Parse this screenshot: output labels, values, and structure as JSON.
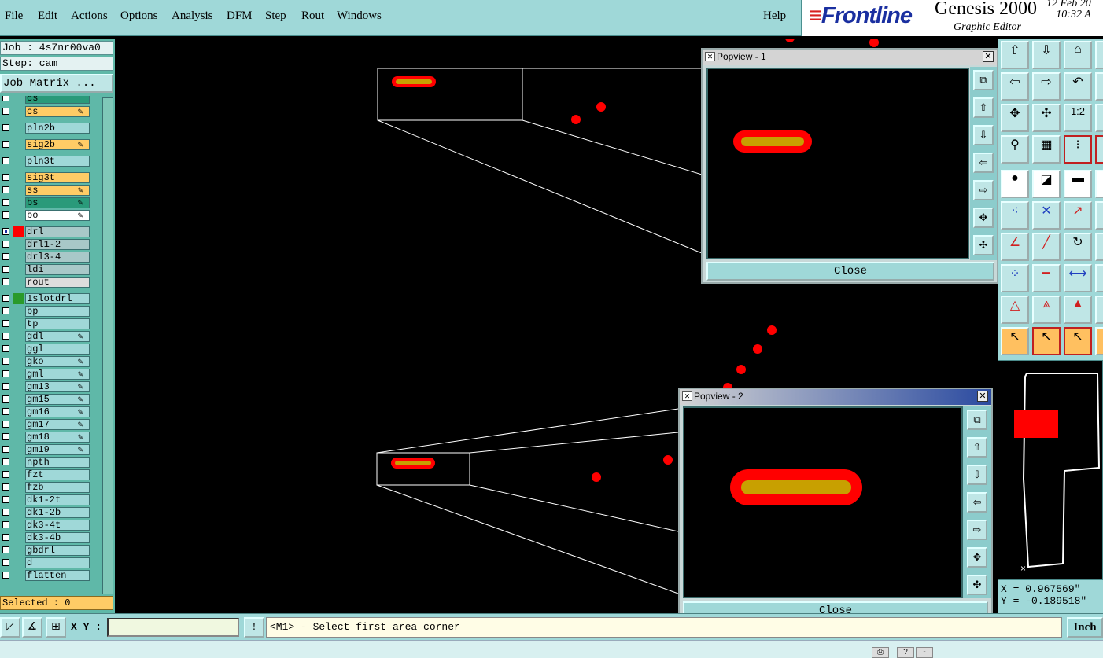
{
  "menu": {
    "items": [
      "File",
      "Edit",
      "Actions",
      "Options",
      "Analysis",
      "DFM",
      "Step",
      "Rout",
      "Windows"
    ],
    "help": "Help"
  },
  "branding": {
    "company": "Frontline",
    "product": "Genesis 2000",
    "subtitle": "Graphic Editor",
    "date": "12 Feb 20",
    "time": "10:32 A"
  },
  "job": {
    "job_label": "Job : 4s7nr00va0",
    "step_label": "Step: cam",
    "matrix_button": "Job Matrix ..."
  },
  "layers": [
    {
      "name": "cs",
      "color": "#2a9a7a",
      "edit": false,
      "group": 0
    },
    {
      "name": "cs",
      "color": "#ffcc66",
      "edit": true,
      "group": 0
    },
    {
      "name": "pln2b",
      "color": "#9fd8d8",
      "edit": false,
      "group": 1
    },
    {
      "name": "sig2b",
      "color": "#ffcc66",
      "edit": true,
      "group": 1
    },
    {
      "name": "pln3t",
      "color": "#9fd8d8",
      "edit": false,
      "group": 1
    },
    {
      "name": "sig3t",
      "color": "#ffcc66",
      "edit": false,
      "group": 2
    },
    {
      "name": "ss",
      "color": "#ffcc66",
      "edit": true,
      "group": 2
    },
    {
      "name": "bs",
      "color": "#2a9a7a",
      "edit": true,
      "group": 2
    },
    {
      "name": "bo",
      "color": "#ffffff",
      "edit": true,
      "group": 2
    },
    {
      "name": "drl",
      "color": "#a8c8c8",
      "edit": false,
      "group": 3,
      "swatch": "#ff0000",
      "checked": true
    },
    {
      "name": "drl1-2",
      "color": "#a8c8c8",
      "edit": false,
      "group": 3
    },
    {
      "name": "drl3-4",
      "color": "#a8c8c8",
      "edit": false,
      "group": 3
    },
    {
      "name": "ldi",
      "color": "#a8c8c8",
      "edit": false,
      "group": 3
    },
    {
      "name": "rout",
      "color": "#dddddd",
      "edit": false,
      "group": 3
    },
    {
      "name": "1slotdrl",
      "color": "#9fd8d8",
      "edit": false,
      "group": 4,
      "swatch": "#2a9a2a"
    },
    {
      "name": "bp",
      "color": "#9fd8d8",
      "edit": false,
      "group": 4
    },
    {
      "name": "tp",
      "color": "#9fd8d8",
      "edit": false,
      "group": 4
    },
    {
      "name": "gdl",
      "color": "#9fd8d8",
      "edit": true,
      "group": 4
    },
    {
      "name": "ggl",
      "color": "#9fd8d8",
      "edit": false,
      "group": 4
    },
    {
      "name": "gko",
      "color": "#9fd8d8",
      "edit": true,
      "group": 4
    },
    {
      "name": "gml",
      "color": "#9fd8d8",
      "edit": true,
      "group": 4
    },
    {
      "name": "gm13",
      "color": "#9fd8d8",
      "edit": true,
      "group": 4
    },
    {
      "name": "gm15",
      "color": "#9fd8d8",
      "edit": true,
      "group": 4
    },
    {
      "name": "gm16",
      "color": "#9fd8d8",
      "edit": true,
      "group": 4
    },
    {
      "name": "gm17",
      "color": "#9fd8d8",
      "edit": true,
      "group": 4
    },
    {
      "name": "gm18",
      "color": "#9fd8d8",
      "edit": true,
      "group": 4
    },
    {
      "name": "gm19",
      "color": "#9fd8d8",
      "edit": true,
      "group": 4
    },
    {
      "name": "npth",
      "color": "#9fd8d8",
      "edit": false,
      "group": 4
    },
    {
      "name": "fzt",
      "color": "#9fd8d8",
      "edit": false,
      "group": 4
    },
    {
      "name": "fzb",
      "color": "#9fd8d8",
      "edit": false,
      "group": 4
    },
    {
      "name": "dk1-2t",
      "color": "#9fd8d8",
      "edit": false,
      "group": 4
    },
    {
      "name": "dk1-2b",
      "color": "#9fd8d8",
      "edit": false,
      "group": 4
    },
    {
      "name": "dk3-4t",
      "color": "#9fd8d8",
      "edit": false,
      "group": 4
    },
    {
      "name": "dk3-4b",
      "color": "#9fd8d8",
      "edit": false,
      "group": 4
    },
    {
      "name": "gbdrl",
      "color": "#9fd8d8",
      "edit": false,
      "group": 4
    },
    {
      "name": "d",
      "color": "#9fd8d8",
      "edit": false,
      "group": 4
    },
    {
      "name": "flatten",
      "color": "#9fd8d8",
      "edit": false,
      "group": 4
    }
  ],
  "selected_label": "Selected : 0",
  "popview1": {
    "title": "Popview - 1",
    "close_label": "Close"
  },
  "popview2": {
    "title": "Popview - 2",
    "close_label": "Close"
  },
  "coords": {
    "x": "X = 0.967569\"",
    "y": "Y = -0.189518\""
  },
  "status": {
    "xy_label": "X Y :",
    "xy_value": "",
    "message": "<M1> - Select first area corner",
    "units": "Inch"
  },
  "colors": {
    "panel": "#9fd8d8",
    "drill_red": "#ff0000",
    "slot_gold": "#c8a000"
  }
}
